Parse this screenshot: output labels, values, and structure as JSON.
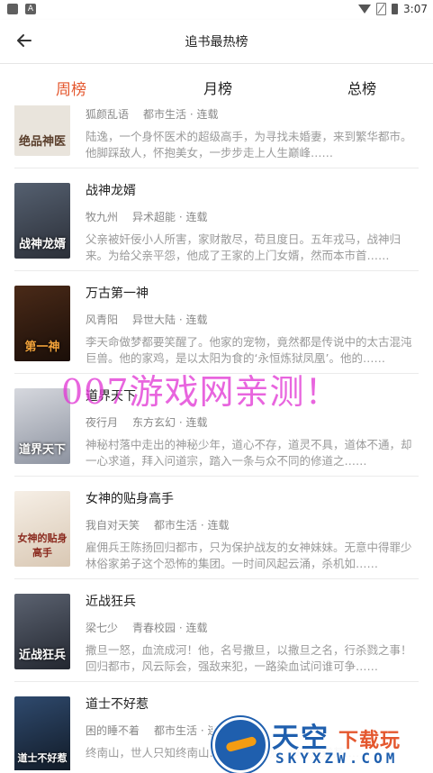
{
  "status_bar": {
    "time": "3:07",
    "icons": [
      "notification-icon",
      "a-badge-icon",
      "wifi-icon",
      "no-sim-icon",
      "battery-icon"
    ]
  },
  "header": {
    "title": "追书最热榜",
    "back_icon": "arrow-left-icon"
  },
  "tabs": [
    {
      "label": "周榜",
      "active": true
    },
    {
      "label": "月榜",
      "active": false
    },
    {
      "label": "总榜",
      "active": false
    }
  ],
  "books": [
    {
      "title": "",
      "author": "狐颜乱语",
      "category": "都市生活 · 连载",
      "desc": "陆逸，一个身怀医术的超级高手，为寻找未婚妻，来到繁华都市。他脚踩敌人，怀抱美女，一步步走上人生巅峰……",
      "cover_text": "绝品神医",
      "cover_color": "#e9e4dc"
    },
    {
      "title": "战神龙婿",
      "author": "牧九州",
      "category": "异术超能 · 连载",
      "desc": "父亲被奸佞小人所害，家财散尽，苟且度日。五年戎马，战神归来。为给父亲平怨，他成了王家的上门女婿，然而本市首……",
      "cover_text": "战神龙婿",
      "cover_color": "#3b3f4a"
    },
    {
      "title": "万古第一神",
      "author": "风青阳",
      "category": "异世大陆 · 连载",
      "desc": "李天命做梦都要笑醒了。他家的宠物，竟然都是传说中的太古混沌巨兽。他的家鸡，是以太阳为食的‘永恒炼狱凤凰’。他的……",
      "cover_text": "第一神",
      "cover_color": "#2a1a12"
    },
    {
      "title": "道界天下",
      "author": "夜行月",
      "category": "东方玄幻 · 连载",
      "desc": "神秘村落中走出的神秘少年，道心不存，道灵不具，道体不通，却一心求道，拜入问道宗，踏入一条与众不同的修道之……",
      "cover_text": "道界天下",
      "cover_color": "#b9bcc4"
    },
    {
      "title": "女神的贴身高手",
      "author": "我自对天笑",
      "category": "都市生活 · 连载",
      "desc": "雇佣兵王陈扬回归都市，只为保护战友的女神妹妹。无意中得罪少林俗家弟子这个恐怖的集团。一时间风起云涌，杀机如……",
      "cover_text": "女神的贴身高手",
      "cover_color": "#efe7dc"
    },
    {
      "title": "近战狂兵",
      "author": "梁七少",
      "category": "青春校园 · 连载",
      "desc": "撒旦一怒，血流成河！他，名号撒旦，以撒旦之名，行杀戮之事！回归都市，风云际会，强敌来犯，一路染血试问谁可争……",
      "cover_text": "近战狂兵",
      "cover_color": "#2f3440"
    },
    {
      "title": "道士不好惹",
      "author": "困的睡不着",
      "category": "都市生活 · 连载",
      "desc": "终南山，世人只知终南山……败的道观，却不知道其……",
      "cover_text": "道士不好惹",
      "cover_color": "#1d2a3c"
    }
  ],
  "watermarks": {
    "overlay": "007游戏网亲测！",
    "logo_cn": "天空",
    "logo_cn2": "下载玩",
    "logo_en": "SKYXZW.COM"
  },
  "colors": {
    "accent": "#e4572e",
    "text": "#222222",
    "secondary": "#888888"
  }
}
